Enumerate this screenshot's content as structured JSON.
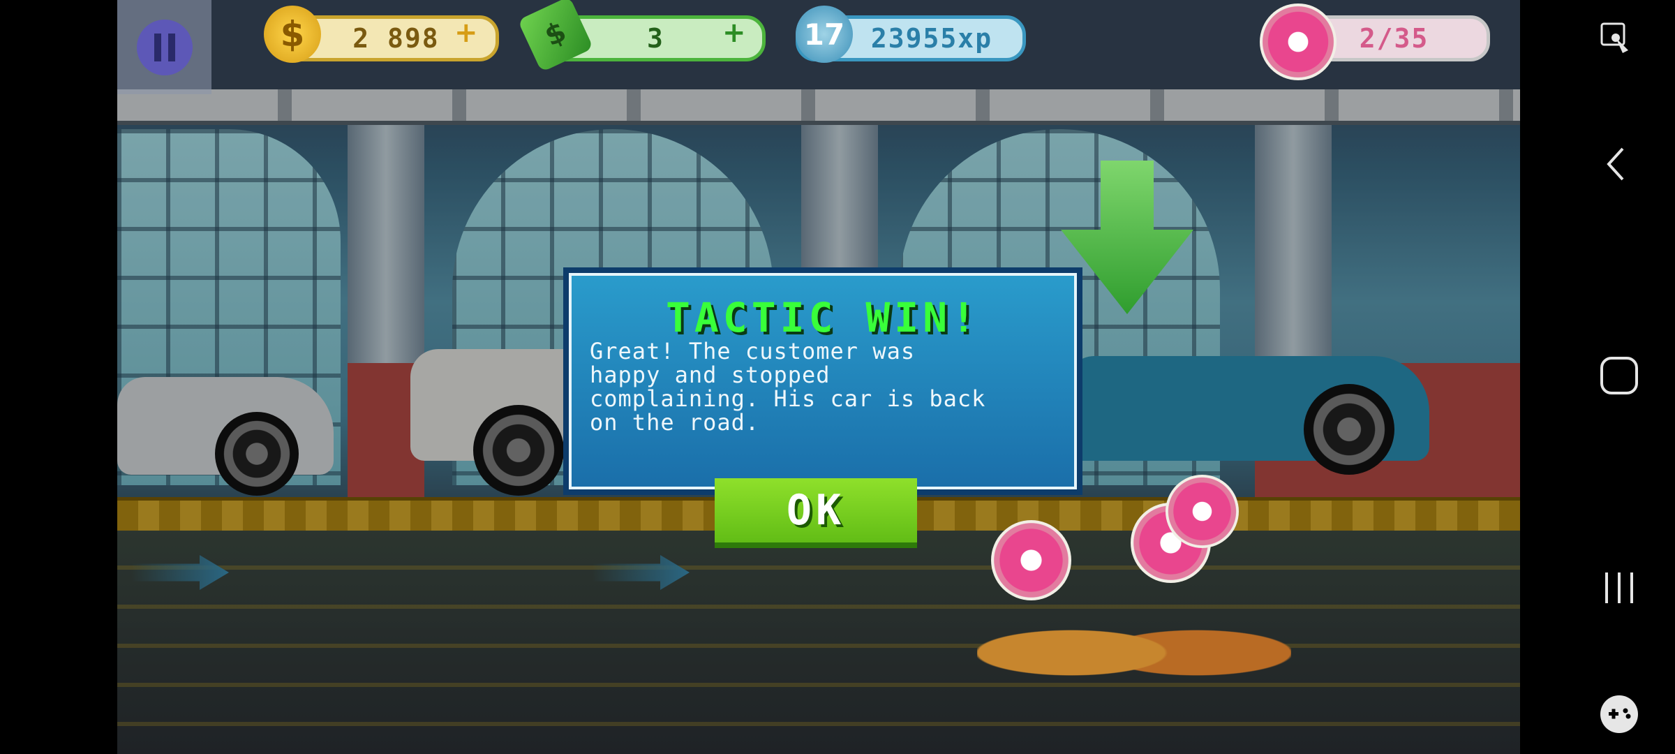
{
  "hud": {
    "coins": "2 898",
    "cash": "3",
    "level": "17",
    "xp": "23955xp",
    "donuts": "2/35"
  },
  "modal": {
    "title": "TACTIC WIN!",
    "message": "Great! The customer was\nhappy and stopped\ncomplaining. His car is back\non the road.",
    "ok_label": "OK"
  },
  "colors": {
    "title_green": "#39ff3a",
    "modal_blue": "#1f87bd",
    "ok_green": "#7ad322"
  },
  "nav": {
    "icons": [
      "screen-touch-icon",
      "back-icon",
      "home-icon",
      "recents-icon",
      "game-tools-icon"
    ]
  }
}
